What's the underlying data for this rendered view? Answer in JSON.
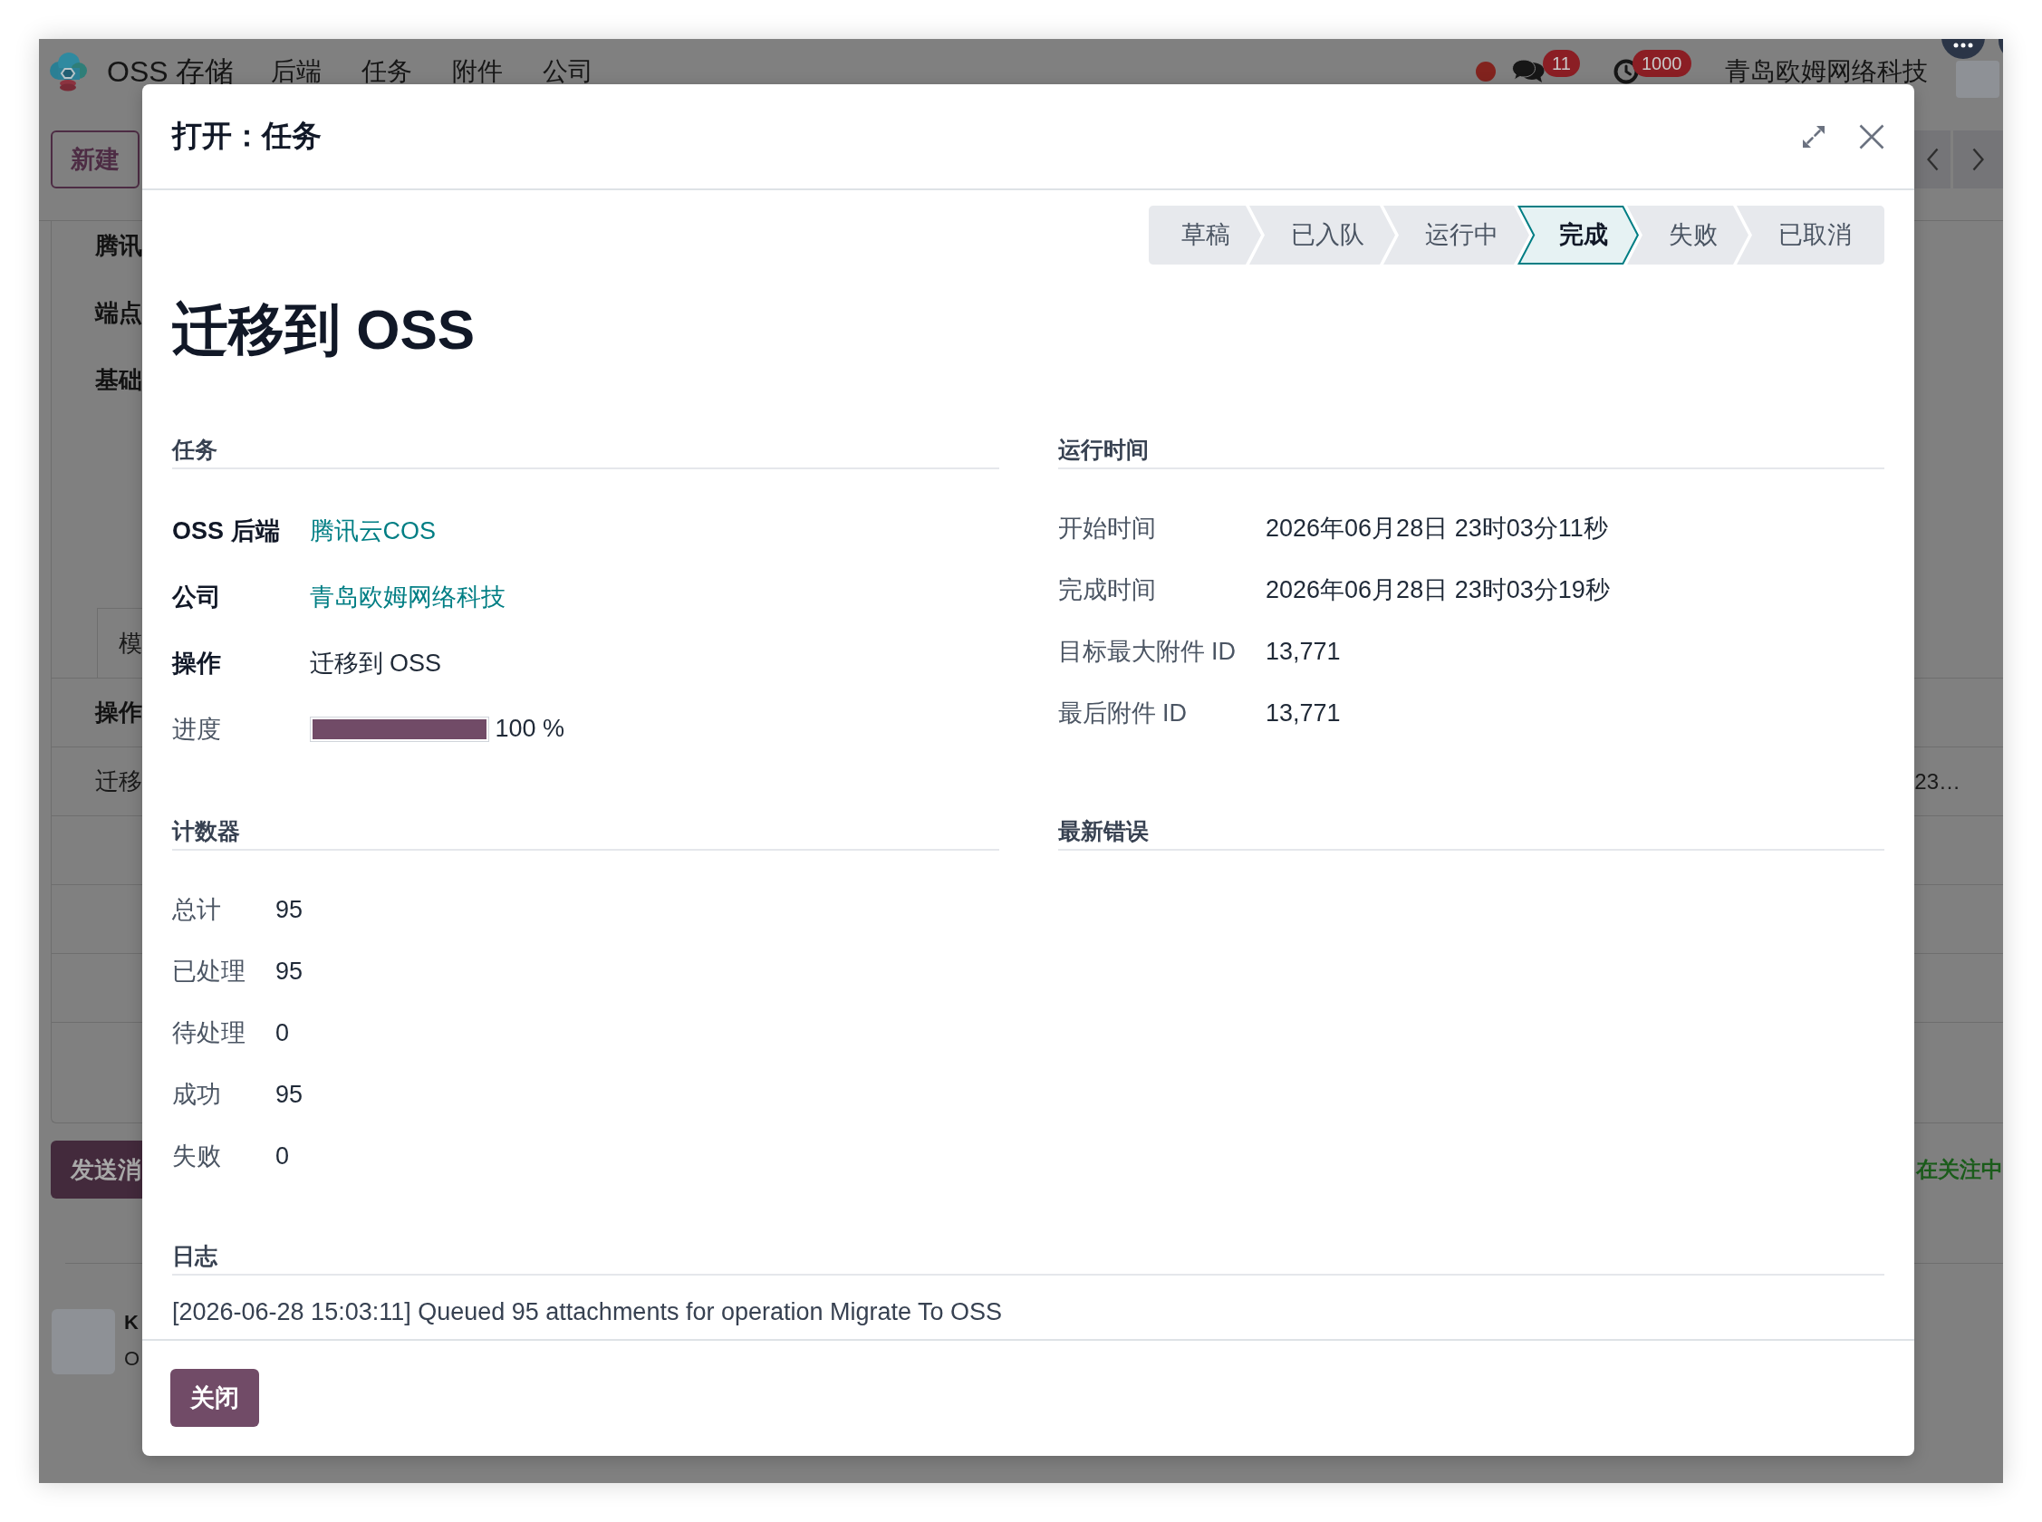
{
  "navbar": {
    "app_name": "OSS 存储",
    "menu": [
      "后端",
      "任务",
      "附件",
      "公司"
    ],
    "messages_badge": "11",
    "activities_badge": "1000",
    "company": "青岛欧姆网络科技"
  },
  "control_panel": {
    "new_button": "新建"
  },
  "background_form": {
    "fields": [
      "腾讯",
      "端点",
      "基础"
    ],
    "tab": "模",
    "table": {
      "columns": [
        "操作"
      ],
      "rows": [
        [
          "迁移",
          "23…"
        ]
      ]
    },
    "send_button": "发送消",
    "follow_status": "在关注中",
    "message": {
      "author": "K",
      "text": "O"
    }
  },
  "dialog": {
    "title": "打开：任务",
    "stages": [
      {
        "label": "草稿",
        "selected": false
      },
      {
        "label": "已入队",
        "selected": false
      },
      {
        "label": "运行中",
        "selected": false
      },
      {
        "label": "完成",
        "selected": true
      },
      {
        "label": "失败",
        "selected": false
      },
      {
        "label": "已取消",
        "selected": false
      }
    ],
    "record_title": "迁移到 OSS",
    "group_rows": [
      {
        "groups": [
          {
            "title": "任务",
            "fields": [
              {
                "label": "OSS 后端",
                "kind": "link",
                "value": "腾讯云COS",
                "readonly": false
              },
              {
                "label": "公司",
                "kind": "link",
                "value": "青岛欧姆网络科技",
                "readonly": false
              },
              {
                "label": "操作",
                "kind": "text",
                "value": "迁移到 OSS",
                "readonly": false
              },
              {
                "label": "进度",
                "kind": "progress",
                "level": 1,
                "value": "100 %",
                "readonly": true
              }
            ]
          },
          {
            "title": "运行时间",
            "fields": [
              {
                "label": "开始时间",
                "kind": "text",
                "value": "2026年06月28日 23时03分11秒",
                "readonly": true
              },
              {
                "label": "完成时间",
                "kind": "text",
                "value": "2026年06月28日 23时03分19秒",
                "readonly": true
              },
              {
                "label": "目标最大附件 ID",
                "kind": "text",
                "value": "13,771",
                "readonly": true
              },
              {
                "label": "最后附件 ID",
                "kind": "text",
                "value": "13,771",
                "readonly": true
              }
            ]
          }
        ]
      },
      {
        "groups": [
          {
            "title": "计数器",
            "fields": [
              {
                "label": "总计",
                "kind": "text",
                "value": "95",
                "readonly": true
              },
              {
                "label": "已处理",
                "kind": "text",
                "value": "95",
                "readonly": true
              },
              {
                "label": "待处理",
                "kind": "text",
                "value": "0",
                "readonly": true
              },
              {
                "label": "成功",
                "kind": "text",
                "value": "95",
                "readonly": true
              },
              {
                "label": "失败",
                "kind": "text",
                "value": "0",
                "readonly": true
              }
            ]
          },
          {
            "title": "最新错误"
          }
        ]
      },
      {
        "groups": [
          {
            "title": "日志",
            "log": "[2026-06-28 15:03:11] Queued 95 attachments for operation Migrate To OSS"
          }
        ]
      }
    ],
    "close_button": "关闭"
  }
}
